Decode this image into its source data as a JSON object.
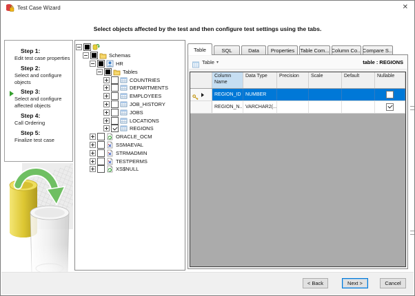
{
  "window": {
    "title": "Test Case Wizard",
    "close_glyph": "✕"
  },
  "header": {
    "instruction": "Select objects affected by the test and then configure test settings using the tabs."
  },
  "steps": {
    "items": [
      {
        "title": "Step 1:",
        "desc": "Edit test case properties",
        "current": false
      },
      {
        "title": "Step 2:",
        "desc": "Select and configure objects",
        "current": false
      },
      {
        "title": "Step 3:",
        "desc": "Select and configure affected objects",
        "current": true
      },
      {
        "title": "Step 4:",
        "desc": "Call Ordering",
        "current": false
      },
      {
        "title": "Step 5:",
        "desc": "Finalize test case",
        "current": false
      }
    ]
  },
  "tree": {
    "items": [
      {
        "label": "",
        "indent": 0,
        "expander": "minus",
        "check": "partial",
        "icon": "root"
      },
      {
        "label": "Schemas",
        "indent": 1,
        "expander": "minus",
        "check": "partial",
        "icon": "folder"
      },
      {
        "label": "HR",
        "indent": 2,
        "expander": "minus",
        "check": "partial",
        "icon": "schema-hr"
      },
      {
        "label": "Tables",
        "indent": 3,
        "expander": "minus",
        "check": "partial",
        "icon": "folder"
      },
      {
        "label": "COUNTRIES",
        "indent": 4,
        "expander": "plus",
        "check": "unchecked",
        "icon": "table"
      },
      {
        "label": "DEPARTMENTS",
        "indent": 4,
        "expander": "plus",
        "check": "unchecked",
        "icon": "table"
      },
      {
        "label": "EMPLOYEES",
        "indent": 4,
        "expander": "plus",
        "check": "unchecked",
        "icon": "table"
      },
      {
        "label": "JOB_HISTORY",
        "indent": 4,
        "expander": "plus",
        "check": "unchecked",
        "icon": "table"
      },
      {
        "label": "JOBS",
        "indent": 4,
        "expander": "plus",
        "check": "unchecked",
        "icon": "table"
      },
      {
        "label": "LOCATIONS",
        "indent": 4,
        "expander": "plus",
        "check": "unchecked",
        "icon": "table"
      },
      {
        "label": "REGIONS",
        "indent": 4,
        "expander": "plus",
        "check": "checked",
        "icon": "table"
      },
      {
        "label": "ORACLE_OCM",
        "indent": 2,
        "expander": "plus",
        "check": "unchecked",
        "icon": "schema-refresh"
      },
      {
        "label": "SSMAEVAL",
        "indent": 2,
        "expander": "plus",
        "check": "unchecked",
        "icon": "schema-x"
      },
      {
        "label": "STRMADMIN",
        "indent": 2,
        "expander": "plus",
        "check": "unchecked",
        "icon": "schema-x"
      },
      {
        "label": "TESTPERMS",
        "indent": 2,
        "expander": "plus",
        "check": "unchecked",
        "icon": "schema-x"
      },
      {
        "label": "XS$NULL",
        "indent": 2,
        "expander": "plus",
        "check": "unchecked",
        "icon": "schema-refresh"
      }
    ]
  },
  "tabs": {
    "items": [
      {
        "label": "Table",
        "active": true
      },
      {
        "label": "SQL",
        "active": false
      },
      {
        "label": "Data",
        "active": false
      },
      {
        "label": "Properties",
        "active": false
      },
      {
        "label": "Table Com...",
        "active": false
      },
      {
        "label": "Column Co...",
        "active": false
      },
      {
        "label": "Compare S...",
        "active": false
      }
    ]
  },
  "toolbar": {
    "table_menu_label": "Table",
    "dropdown_glyph": "▾",
    "context_label": "table : REGIONS"
  },
  "grid": {
    "columns": [
      "Column Name",
      "Data Type",
      "Precision",
      "Scale",
      "Default",
      "Nullable"
    ],
    "selected_column": "Column Name",
    "rows": [
      {
        "cells": [
          "REGION_ID",
          "NUMBER",
          "",
          "",
          ""
        ],
        "nullable": false,
        "selected": true,
        "has_key": true
      },
      {
        "cells": [
          "REGION_N...",
          "VARCHAR2(...",
          "",
          "",
          ""
        ],
        "nullable": true,
        "selected": false,
        "has_key": false
      }
    ]
  },
  "buttons": {
    "back": "< Back",
    "next": "Next >",
    "cancel": "Cancel"
  },
  "colors": {
    "selection": "#0078d7",
    "selected_column_header": "#c6def2",
    "grid_filler": "#ababab",
    "step_arrow_green": "#35a02f",
    "focus_border": "#0078d7"
  }
}
